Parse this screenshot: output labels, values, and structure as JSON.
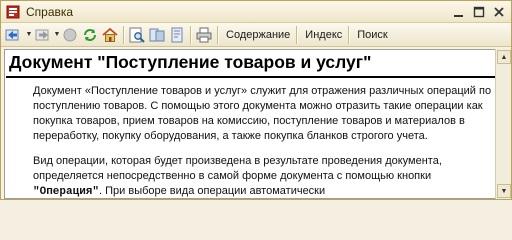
{
  "window": {
    "title": "Справка",
    "controls": [
      "—",
      "□",
      "✕"
    ]
  },
  "toolbar": {
    "contents_label": "Содержание",
    "index_label": "Индекс",
    "search_label": "Поиск"
  },
  "document": {
    "heading": "Документ \"Поступление товаров и услуг\"",
    "paragraph1": "Документ «Поступление товаров и услуг» служит для отражения различных операций по поступлению товаров. С помощью этого документа можно отразить такие операции как покупка товаров, прием товаров на комиссию, поступление товаров и материалов в переработку, покупку оборудования, а также покупка бланков строгого учета.",
    "paragraph2_start": "Вид операции, которая будет произведена в результате проведения документа, определяется непосредственно в самой форме документа с помощью кнопки ",
    "paragraph2_bold": "\"Операция\"",
    "paragraph2_end": ". При выборе вида операции автоматически"
  },
  "icons": {
    "title": "help-book-icon",
    "back": "back-arrow-icon",
    "forward": "forward-arrow-icon",
    "stop": "stop-icon",
    "refresh": "refresh-icon",
    "home": "home-icon",
    "find": "find-in-page-icon",
    "sync": "sync-contents-icon",
    "print": "print-icon"
  },
  "colors": {
    "titlebar": "#efe6c9",
    "border": "#b8a45a",
    "accent_red": "#c02a1a"
  }
}
